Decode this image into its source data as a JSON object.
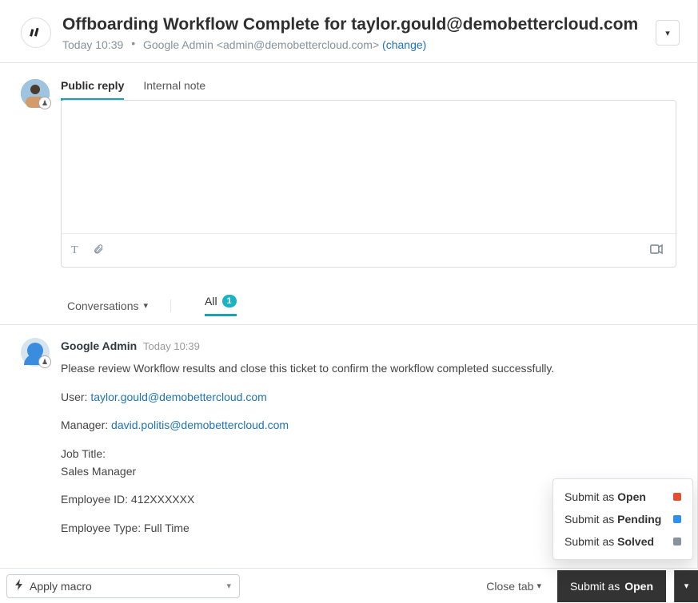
{
  "header": {
    "title": "Offboarding Workflow Complete for taylor.gould@demobettercloud.com",
    "timestamp": "Today 10:39",
    "requester_label": "Google Admin",
    "requester_email": "<admin@demobettercloud.com>",
    "change_label": "(change)"
  },
  "composer": {
    "tabs": {
      "public": "Public reply",
      "internal": "Internal note"
    }
  },
  "filters": {
    "conversations": "Conversations",
    "all": "All",
    "count": "1"
  },
  "message": {
    "author": "Google Admin",
    "time": "Today 10:39",
    "intro": "Please review Workflow results and close this ticket to confirm the workflow completed successfully.",
    "user_label": "User: ",
    "user_value": "taylor.gould@demobettercloud.com",
    "manager_label": "Manager: ",
    "manager_value": "david.politis@demobettercloud.com",
    "job_title_label": "Job Title:",
    "job_title_value": "Sales Manager",
    "emp_id": "Employee ID: 412XXXXXX",
    "emp_type": "Employee Type: Full Time"
  },
  "submit_menu": {
    "prefix": "Submit as ",
    "open": "Open",
    "pending": "Pending",
    "solved": "Solved"
  },
  "footer": {
    "macro": "Apply macro",
    "close_tab": "Close tab",
    "submit_prefix": "Submit as ",
    "submit_state": "Open"
  }
}
